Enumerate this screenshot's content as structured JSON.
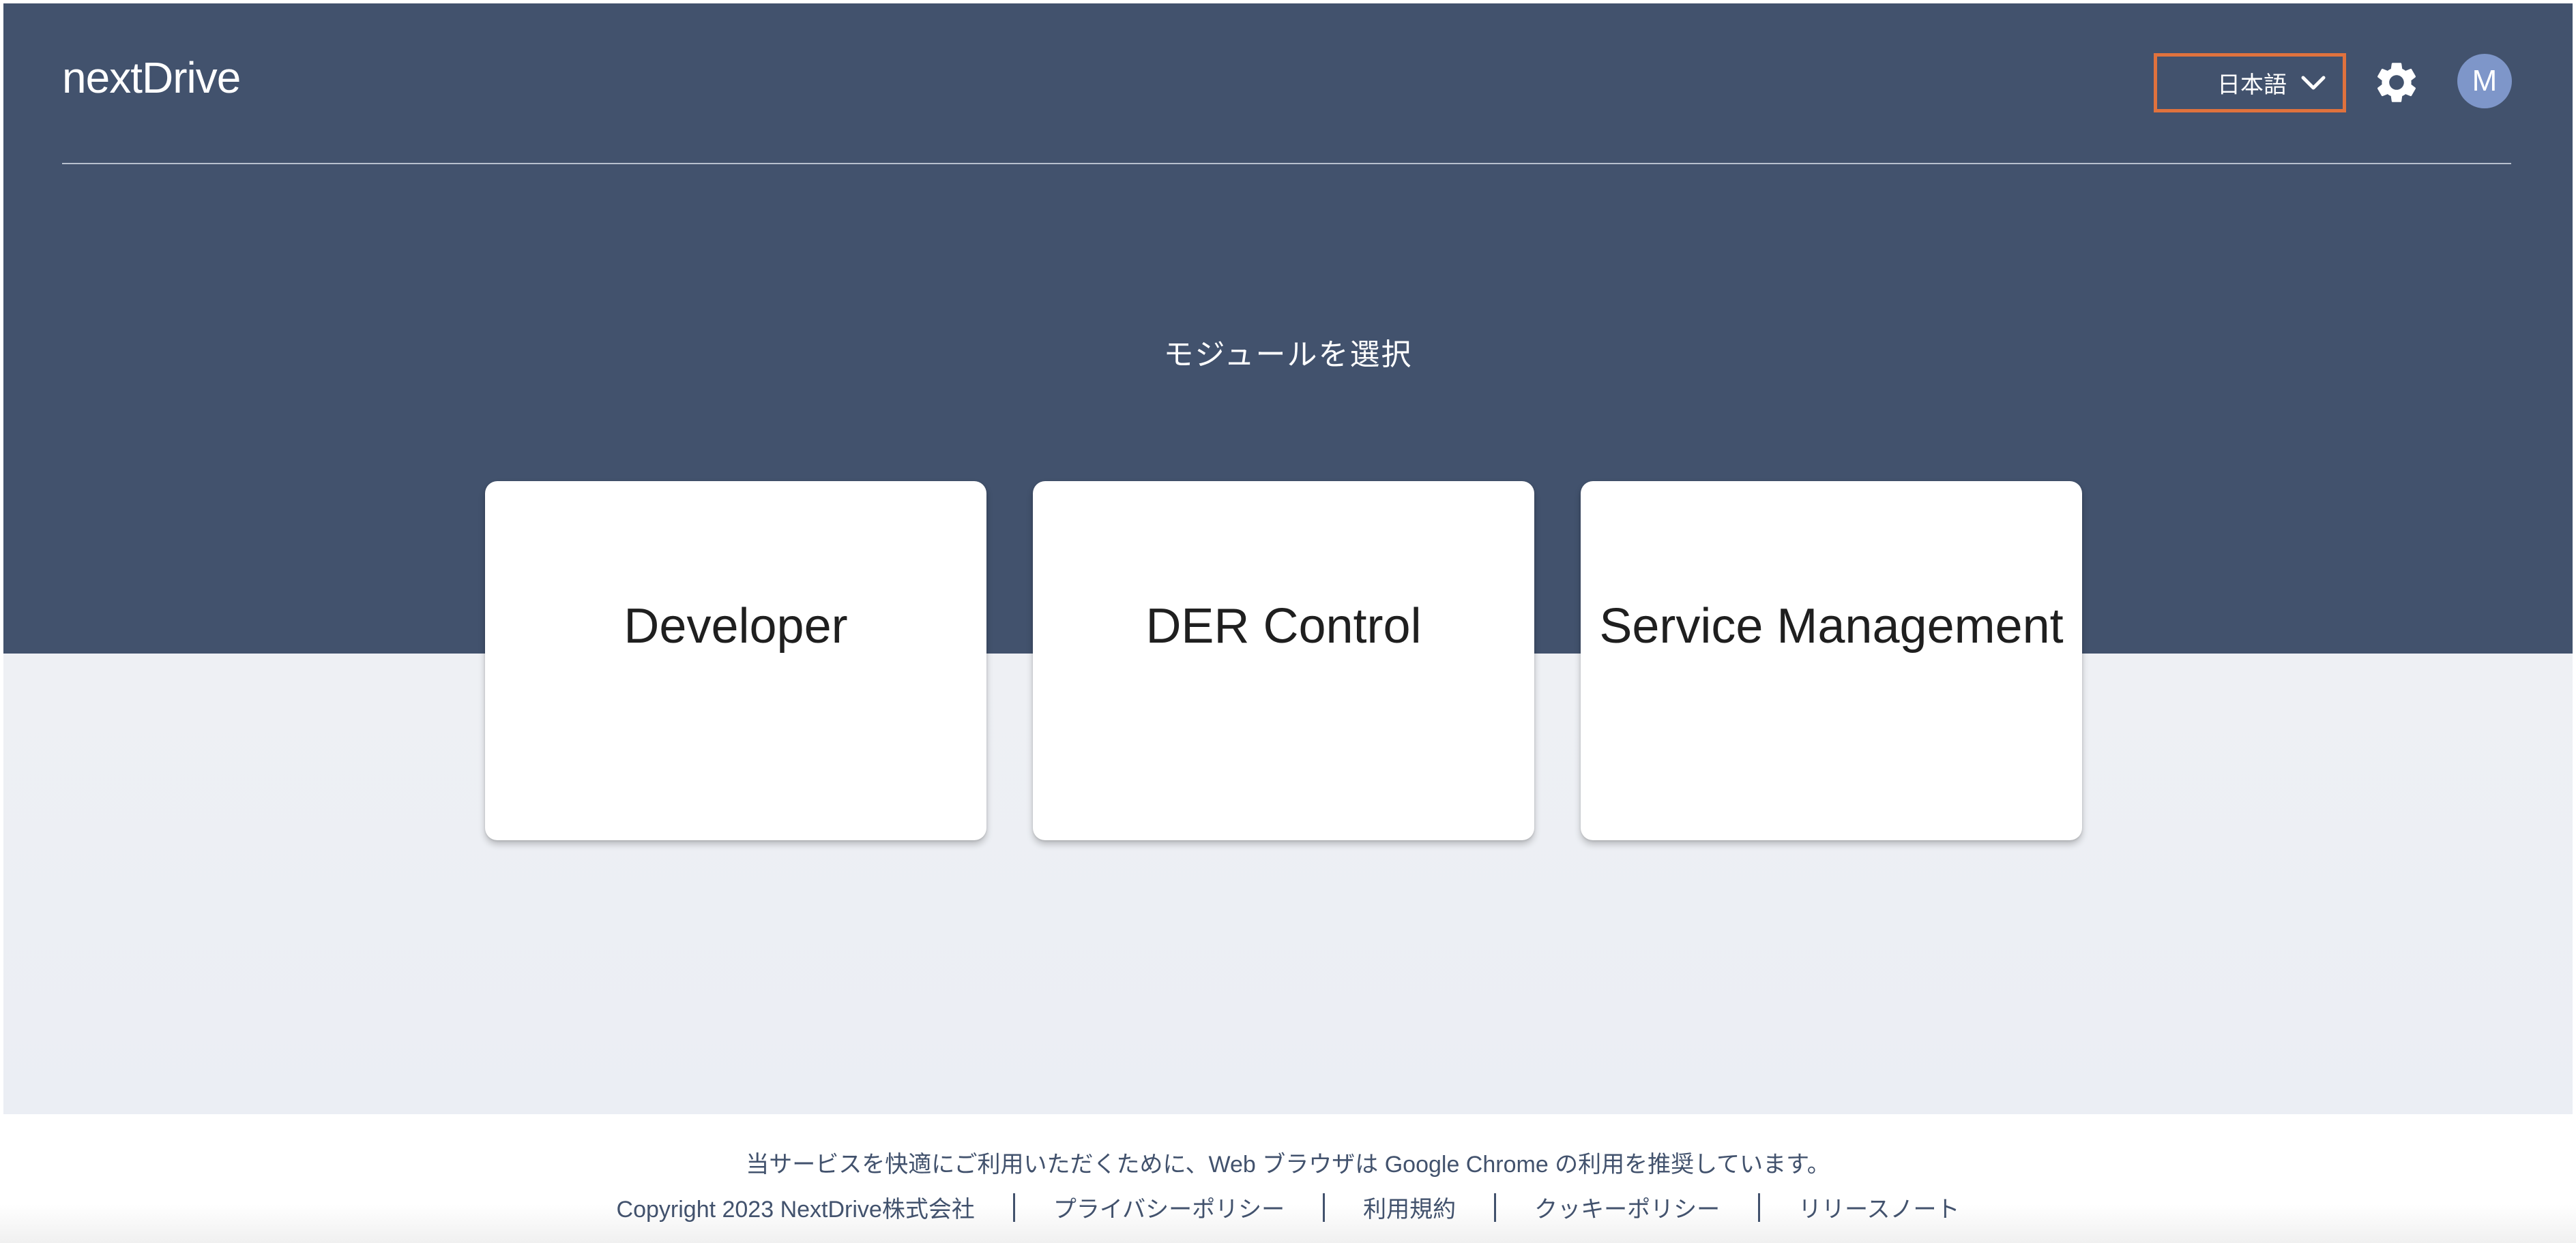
{
  "header": {
    "logo_text": "nextDrive",
    "language": {
      "selected": "日本語",
      "icon": "chevron-down-icon"
    },
    "settings_icon": "gear-icon",
    "avatar_initial": "M",
    "colors": {
      "header_bg": "#42526d",
      "highlight_border": "#e0723d",
      "avatar_bg": "#7e96c9"
    }
  },
  "main": {
    "heading": "モジュールを選択",
    "modules": [
      {
        "label": "Developer"
      },
      {
        "label": "DER Control"
      },
      {
        "label": "Service Management"
      }
    ]
  },
  "footer": {
    "notice": "当サービスを快適にご利用いただくために、Web ブラウザは Google Chrome の利用を推奨しています。",
    "copyright": "Copyright 2023 NextDrive株式会社",
    "links": [
      {
        "label": "プライバシーポリシー"
      },
      {
        "label": "利用規約"
      },
      {
        "label": "クッキーポリシー"
      },
      {
        "label": "リリースノート"
      }
    ]
  }
}
